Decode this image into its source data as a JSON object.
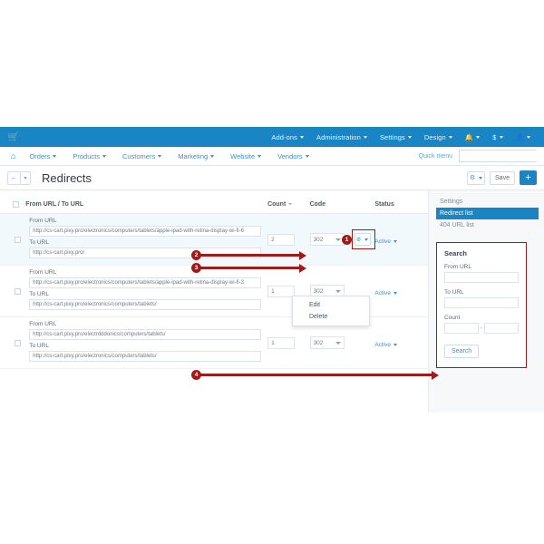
{
  "topbar": {
    "logo_icon": "cart-icon",
    "items": [
      {
        "label": "Add-ons",
        "caret": true
      },
      {
        "label": "Administration",
        "caret": true
      },
      {
        "label": "Settings",
        "caret": true
      },
      {
        "label": "Design",
        "caret": true
      }
    ],
    "bell_icon": "bell-icon",
    "currency_label": "$",
    "user_icon": "user-icon"
  },
  "navbar": {
    "home_icon": "home-icon",
    "items": [
      {
        "label": "Orders"
      },
      {
        "label": "Products"
      },
      {
        "label": "Customers"
      },
      {
        "label": "Marketing"
      },
      {
        "label": "Website"
      },
      {
        "label": "Vendors"
      }
    ],
    "quick_menu_label": "Quick menu",
    "search_value": "",
    "search_placeholder": "",
    "search_icon": "search-icon"
  },
  "titlebar": {
    "back_icon": "arrow-left-icon",
    "back_caret_icon": "chevron-down-icon",
    "title": "Redirects",
    "gear_icon": "gear-icon",
    "save_label": "Save",
    "add_label": "+"
  },
  "table": {
    "headers": {
      "checkbox": "",
      "url": "From URL   / To URL",
      "count": "Count",
      "code": "Code",
      "status": "Status"
    },
    "from_url_label": "From URL",
    "to_url_label": "To URL",
    "rows": [
      {
        "from_url": "http://cs-cart.pixy.pro/electronics/computers/tablets/apple-ipad-with-retina-display-wi-fi-6",
        "to_url": "http://cs-cart.pixy.pro/",
        "count": "2",
        "code": "302",
        "status": "Active",
        "highlighted": true
      },
      {
        "from_url": "http://cs-cart.pixy.pro/electronics/computers/tablets/apple-ipad-with-retina-display-wi-fi-3",
        "to_url": "http://cs-cart.pixy.pro/electronics/computers/tablets/",
        "count": "1",
        "code": "302",
        "status": "Active",
        "highlighted": false
      },
      {
        "from_url": "http://cs-cart.pixy.pro/electrdddonics/computers/tablets/",
        "to_url": "http://cs-cart.pixy.pro/electronics/computers/tablets/",
        "count": "1",
        "code": "302",
        "status": "Active",
        "highlighted": false
      }
    ]
  },
  "dropdown": {
    "edit_label": "Edit",
    "delete_label": "Delete"
  },
  "sidebar": {
    "section_label": "Settings",
    "items": [
      {
        "label": "Redirect list",
        "active": true
      },
      {
        "label": "404 URL list",
        "active": false
      }
    ]
  },
  "search_panel": {
    "title": "Search",
    "from_url_label": "From URL",
    "from_url_value": "",
    "to_url_label": "To URL",
    "to_url_value": "",
    "count_label": "Count",
    "count_from_value": "",
    "count_to_value": "",
    "count_separator": "-",
    "submit_label": "Search"
  },
  "annotations": {
    "markers": [
      {
        "id": "1",
        "label": "1"
      },
      {
        "id": "2",
        "label": "2"
      },
      {
        "id": "3",
        "label": "3"
      },
      {
        "id": "4",
        "label": "4"
      }
    ],
    "color": "#9e1b1b"
  },
  "colors": {
    "brand_blue": "#1a85c4",
    "link_blue": "#3b93c8",
    "annotation_red": "#9e1b1b",
    "row_highlight": "#f2f9fd"
  }
}
